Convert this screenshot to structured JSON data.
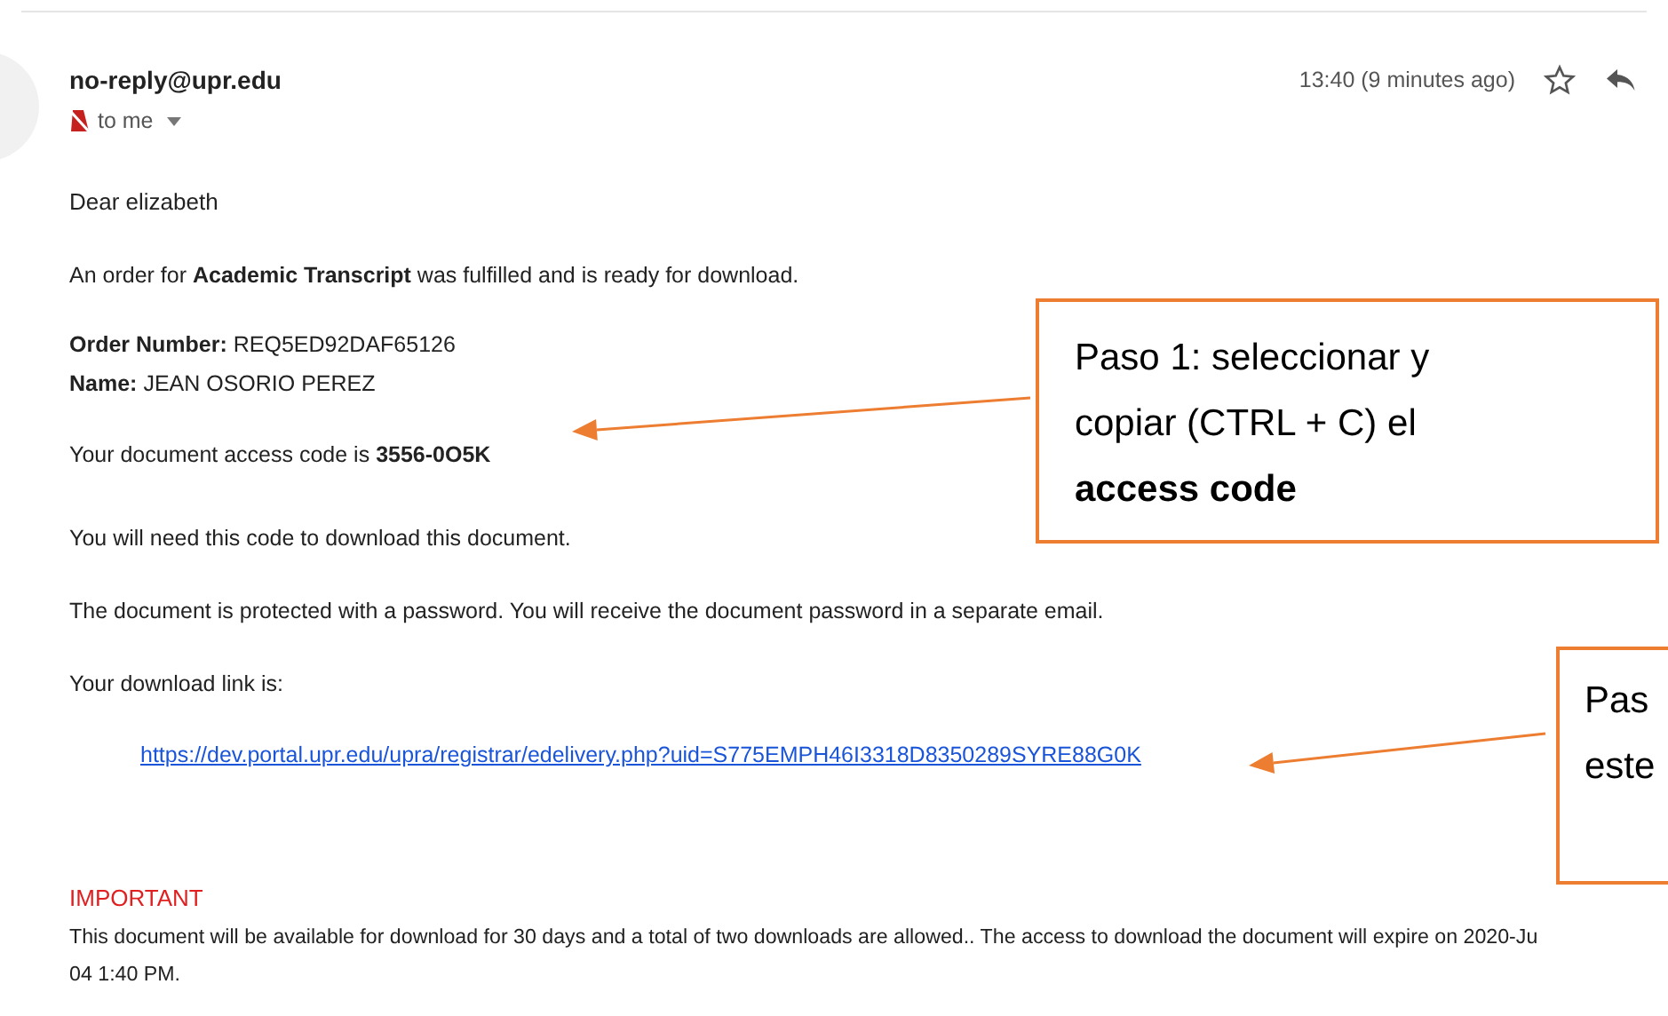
{
  "header": {
    "sender": "no-reply@upr.edu",
    "recipient": "to me",
    "time": "13:40 (9 minutes ago)"
  },
  "body": {
    "greeting": "Dear elizabeth",
    "order_line": "An order for **Academic Transcript** was fulfilled and is ready for download.",
    "details": [
      "**Order Number:** REQ5ED92DAF65126",
      "**Name:** JEAN OSORIO PEREZ"
    ],
    "access_line": "Your document access code is **3556-0O5K**",
    "paragraphs": [
      "You will need this code to download this document.",
      "The document is protected with a password. You will receive the document password in a separate email.",
      "Your download link is:"
    ],
    "link": "https://dev.portal.upr.edu/upra/registrar/edelivery.php?uid=S775EMPH46I3318D8350289SYRE88G0K"
  },
  "important": {
    "heading": "IMPORTANT",
    "lines": [
      "This document will be available for download for 30 days and a total of two downloads are allowed.. The access to download the document will expire on 2020-Ju",
      "04 1:40 PM."
    ]
  },
  "callouts": [
    {
      "text": "Paso 1: seleccionar y copiar (CTRL + C) el **access code**"
    },
    {
      "text": "Pas este"
    }
  ]
}
